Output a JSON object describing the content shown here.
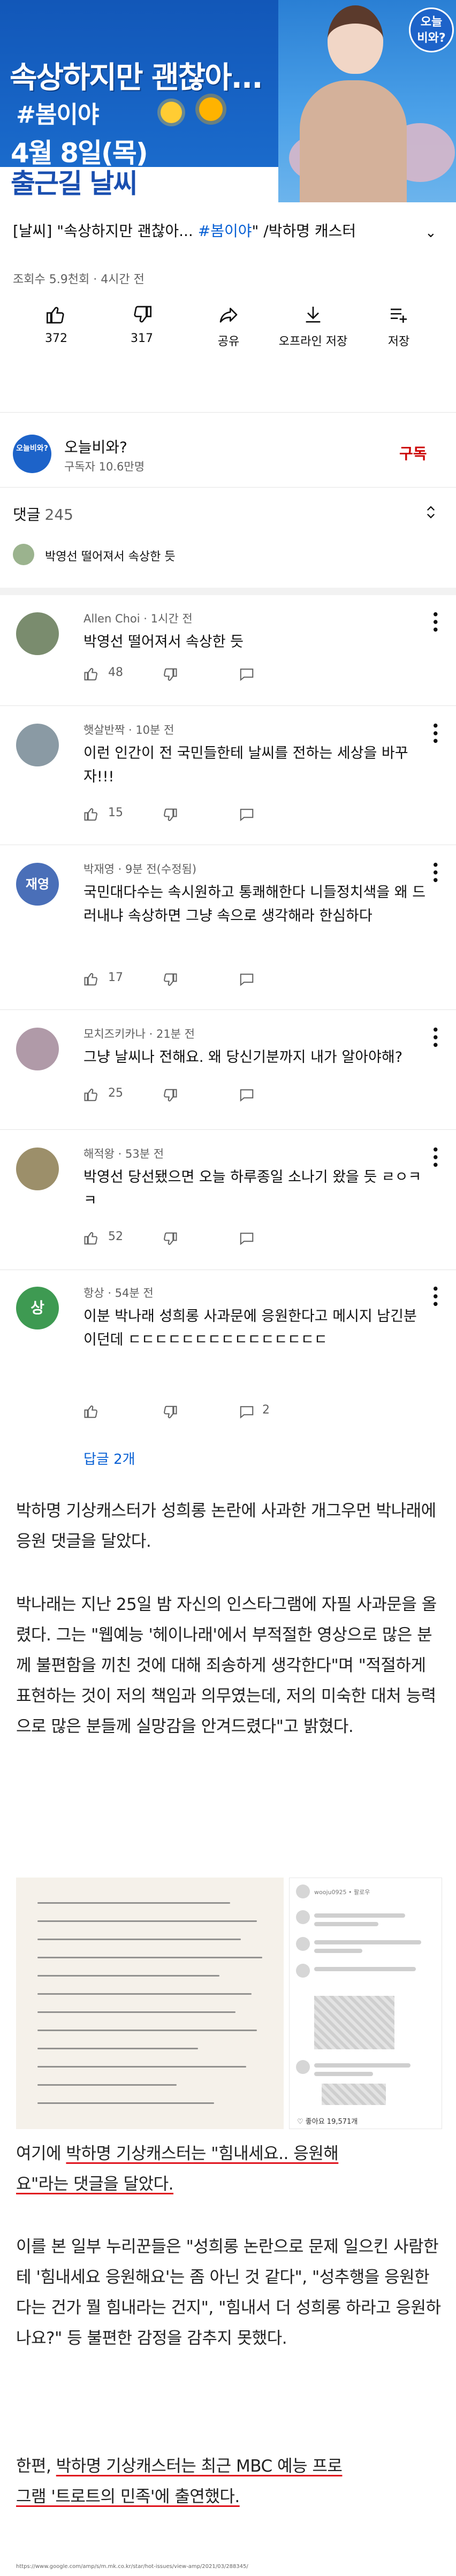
{
  "thumbnail": {
    "headline": "속상하지만 괜찮아...",
    "hashtag": "#봄이야",
    "date": "4월 8일(목)",
    "commute": "출근길 날씨",
    "logo_line1": "오늘",
    "logo_line2": "비와?"
  },
  "video": {
    "title_prefix": "[날씨] \"속상하지만 괜찮아... ",
    "title_tag": "#봄이야",
    "title_suffix": "\" /박하명 캐스터",
    "views": "조회수 5.9천회",
    "age": "4시간 전",
    "meta_sep": "·"
  },
  "actions": [
    {
      "label": "372",
      "icon": "thumbs-up-icon"
    },
    {
      "label": "317",
      "icon": "thumbs-down-icon"
    },
    {
      "label": "공유",
      "icon": "share-icon"
    },
    {
      "label": "오프라인 저장",
      "icon": "download-icon"
    },
    {
      "label": "저장",
      "icon": "save-to-playlist-icon"
    }
  ],
  "channel": {
    "name": "오늘비와?",
    "subscribers": "구독자 10.6만명",
    "subscribe_label": "구독",
    "avatar_text": "오늘비와?"
  },
  "comments_header": {
    "label": "댓글",
    "count": "245",
    "preview_text": "박영선 떨어져서 속상한 듯"
  },
  "comments": [
    {
      "author": "Allen Choi",
      "time": "1시간 전",
      "text": "박영선 떨어져서 속상한 듯",
      "likes": "48",
      "replies": "",
      "avatar_color": "#7a8c6e"
    },
    {
      "author": "햇살반짝",
      "time": "10분 전",
      "text": "이런 인간이 전 국민들한테 날씨를 전하는 세상을 바꾸자!!!",
      "likes": "15",
      "replies": "",
      "avatar_color": "#8a9aa4"
    },
    {
      "author": "박재영",
      "time": "9분 전(수정됨)",
      "text": "국민대다수는 속시원하고 통쾌해한다 니들정치색을 왜 드러내냐 속상하면 그냥 속으로 생각해라 한심하다",
      "likes": "17",
      "replies": "",
      "avatar_color": "#4a6fb8",
      "avatar_text": "재영"
    },
    {
      "author": "모치즈키카나",
      "time": "21분 전",
      "text": "그냥 날씨나 전해요. 왜 당신기분까지 내가 알아야해?",
      "likes": "25",
      "replies": "",
      "avatar_color": "#b09aa8"
    },
    {
      "author": "해적왕",
      "time": "53분 전",
      "text": "박영선 당선됐으면 오늘 하루종일 소나기 왔을 듯 ㄹㅇㅋㅋ",
      "likes": "52",
      "replies": "",
      "avatar_color": "#9c8f6a"
    },
    {
      "author": "항상",
      "time": "54분 전",
      "text": "이분 박나래 성희롱 사과문에 응원한다고 메시지 남긴분이던데 ㄷㄷㄷㄷㄷㄷㄷㄷㄷㄷㄷㄷㄷㄷㄷ",
      "likes": "",
      "replies": "2",
      "avatar_color": "#3e9a52",
      "avatar_text": "상"
    }
  ],
  "replies_link": "답글 2개",
  "article": {
    "p1": "박하명 기상캐스터가 성희롱 논란에 사과한 개그우먼 박나래에 응원 댓글을 달았다.",
    "p2": "박나래는 지난 25일 밤 자신의 인스타그램에 자필 사과문을 올렸다. 그는 \"웹예능 '헤이나래'에서 부적절한 영상으로 많은 분께 불편함을 끼친 것에 대해 죄송하게 생각한다\"며 \"적절하게 표현하는 것이 저의 책임과 의무였는데, 저의 미숙한 대처 능력으로 많은 분들께 실망감을 안겨드렸다\"고 밝혔다.",
    "p3_pre": "여기에 ",
    "p3_hl1": "박하명 기상캐스터는 \"힘내세요.. 응원해",
    "p3_hl2": "요\"라는 댓글을 달았다.",
    "p4": "이를 본 일부 누리꾼들은 \"성희롱 논란으로 문제 일으킨 사람한테 '힘내세요 응원해요'는 좀 아닌 것 같다\", \"성추행을 응원한다는 건가 뭘 힘내라는 건지\", \"힘내서 더 성희롱 하라고 응원하나요?\" 등 불편한 감정을 감추지 못했다.",
    "p5_pre": "한편, ",
    "p5_hl1": "박하명 기상캐스터는 최근 MBC 예능 프로",
    "p5_hl2": "그램 '트로트의 민족'에 출연했다.",
    "photo_account": "wooju0925",
    "photo_account_suffix": "• 팔로우",
    "photo_caption": "♡ 좋아요 19,571개",
    "footer_url": "https://www.google.com/amp/s/m.mk.co.kr/star/hot-issues/view-amp/2021/03/288345/"
  }
}
